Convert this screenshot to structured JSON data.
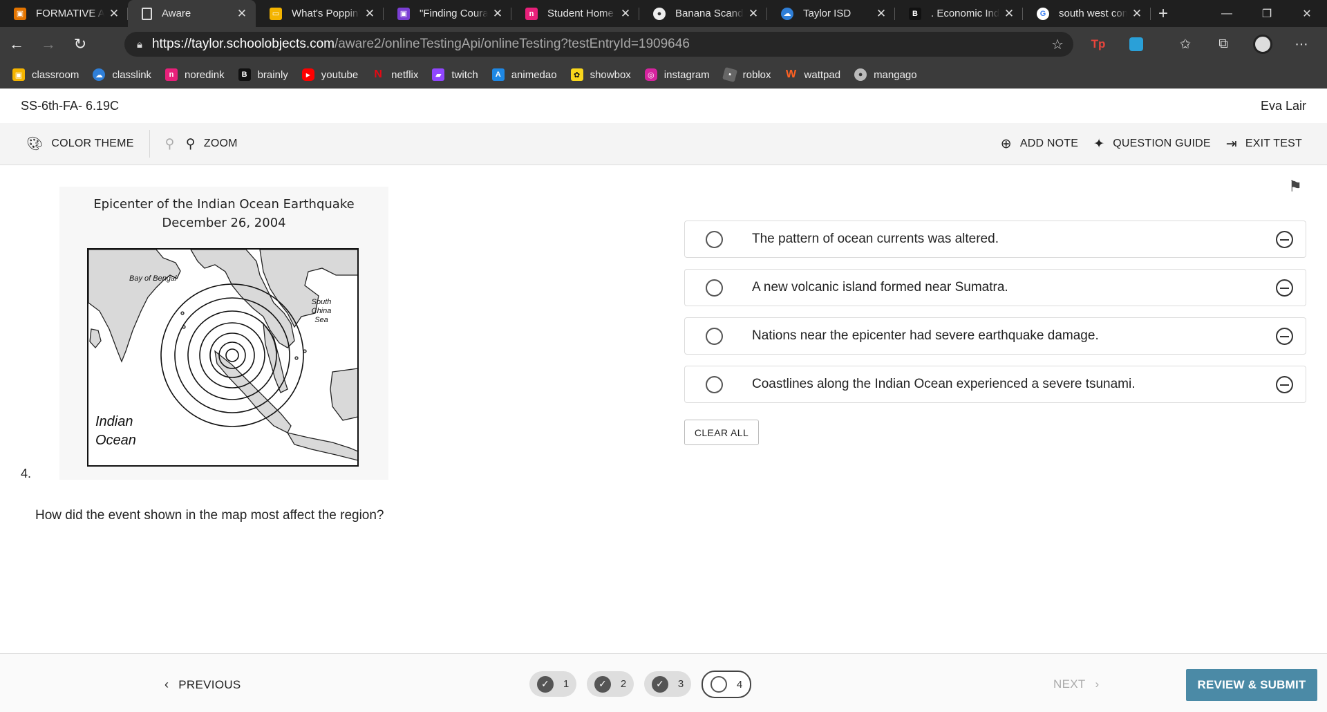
{
  "browser": {
    "tabs": [
      {
        "title": "FORMATIVE AS",
        "icon": "classroom-icon",
        "color": "#e37400",
        "active": false
      },
      {
        "title": "Aware",
        "icon": "page-icon",
        "color": "#3b3b3b",
        "active": true
      },
      {
        "title": "What's Poppin'",
        "icon": "slides-icon",
        "color": "#f4b400",
        "active": false
      },
      {
        "title": "\"Finding Coura",
        "icon": "classroom-icon",
        "color": "#7b3fd4",
        "active": false
      },
      {
        "title": "Student Home",
        "icon": "noredink-icon",
        "color": "#e8207a",
        "active": false
      },
      {
        "title": "Banana Scanda",
        "icon": "reddit-icon",
        "color": "#555555",
        "active": false
      },
      {
        "title": "Taylor ISD",
        "icon": "classlink-icon",
        "color": "#2f7fd8",
        "active": false
      },
      {
        "title": ". Economic Ind",
        "icon": "brainly-icon",
        "color": "#111111",
        "active": false
      },
      {
        "title": "south west con",
        "icon": "google-icon",
        "color": "#ffffff",
        "active": false
      }
    ],
    "url_host": "https://taylor.schoolobjects.com",
    "url_path": "/aware2/onlineTestingApi/onlineTesting?testEntryId=1909646",
    "bookmarks": [
      {
        "label": "classroom",
        "color": "#f4b400"
      },
      {
        "label": "classlink",
        "color": "#2f7fd8"
      },
      {
        "label": "noredink",
        "color": "#e8207a"
      },
      {
        "label": "brainly",
        "color": "#111111"
      },
      {
        "label": "youtube",
        "color": "#ff0000"
      },
      {
        "label": "netflix",
        "color": "#e50914"
      },
      {
        "label": "twitch",
        "color": "#9146ff"
      },
      {
        "label": "animedao",
        "color": "#1e88e5"
      },
      {
        "label": "showbox",
        "color": "#f9d71c"
      },
      {
        "label": "instagram",
        "color": "#d6249f"
      },
      {
        "label": "roblox",
        "color": "#666666"
      },
      {
        "label": "wattpad",
        "color": "#ff6122"
      },
      {
        "label": "mangago",
        "color": "#bbbbbb"
      }
    ]
  },
  "app": {
    "test_name": "SS-6th-FA- 6.19C",
    "student_name": "Eva Lair",
    "toolbar": {
      "color_theme": "COLOR THEME",
      "zoom": "ZOOM",
      "add_note": "ADD NOTE",
      "question_guide": "QUESTION GUIDE",
      "exit_test": "EXIT TEST"
    }
  },
  "question": {
    "number": "4.",
    "map_title_line1": "Epicenter of the Indian Ocean Earthquake",
    "map_title_line2": "December 26, 2004",
    "map_labels": {
      "bay": "Bay of Bengal",
      "sea_line1": "South",
      "sea_line2": "China",
      "sea_line3": "Sea",
      "ocean_line1": "Indian",
      "ocean_line2": "Ocean"
    },
    "text": "How did the event shown in the map most affect the region?",
    "answers": [
      "The pattern of ocean currents was altered.",
      "A new volcanic island formed near Sumatra.",
      "Nations near the epicenter had severe earthquake damage.",
      "Coastlines along the Indian Ocean experienced a severe tsunami."
    ],
    "clear_all": "CLEAR ALL"
  },
  "footer": {
    "previous": "PREVIOUS",
    "next": "NEXT",
    "submit": "REVIEW & SUBMIT",
    "pages": [
      {
        "label": "1",
        "answered": true
      },
      {
        "label": "2",
        "answered": true
      },
      {
        "label": "3",
        "answered": true
      },
      {
        "label": "4",
        "answered": false,
        "current": true
      }
    ]
  },
  "colors": {
    "submit_button": "#4b8aa6",
    "chrome_dark": "#1f1f1f",
    "chrome_mid": "#3b3b3b"
  }
}
